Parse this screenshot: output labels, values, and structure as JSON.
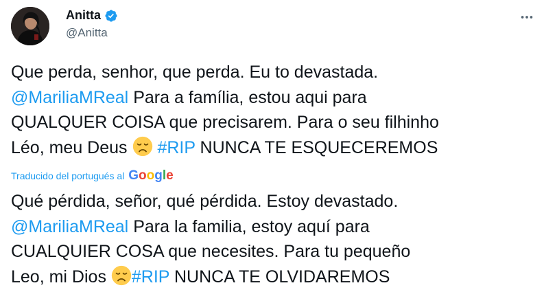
{
  "author": {
    "name": "Anitta",
    "handle": "@Anitta"
  },
  "more_icon": "more-horizontal-icon",
  "tweet": {
    "line1": "Que perda, senhor, que perda. Eu to devastada.",
    "mention": "@MariliaMReal",
    "line2_rest": " Para a família, estou aqui para",
    "line3": "QUALQUER COISA que precisarem. Para o seu filhinho",
    "line4_start": "Léo, meu Deus ",
    "hashtag": "#RIP",
    "line4_end": " NUNCA TE ESQUECEREMOS"
  },
  "translation": {
    "note": "Traducido del portugués al",
    "provider": "Google",
    "line1": "Qué pérdida, señor, qué pérdida. Estoy devastado.",
    "mention": "@MariliaMReal",
    "line2_rest": " Para la familia, estoy aquí para",
    "line3": "CUALQUIER COSA que necesites. Para tu pequeño",
    "line4_start": "Leo, mi Dios ",
    "hashtag": "#RIP",
    "line4_end": " NUNCA TE OLVIDAREMOS"
  },
  "colors": {
    "link": "#1d9bf0",
    "secondary": "#536471",
    "text": "#0f1419"
  }
}
